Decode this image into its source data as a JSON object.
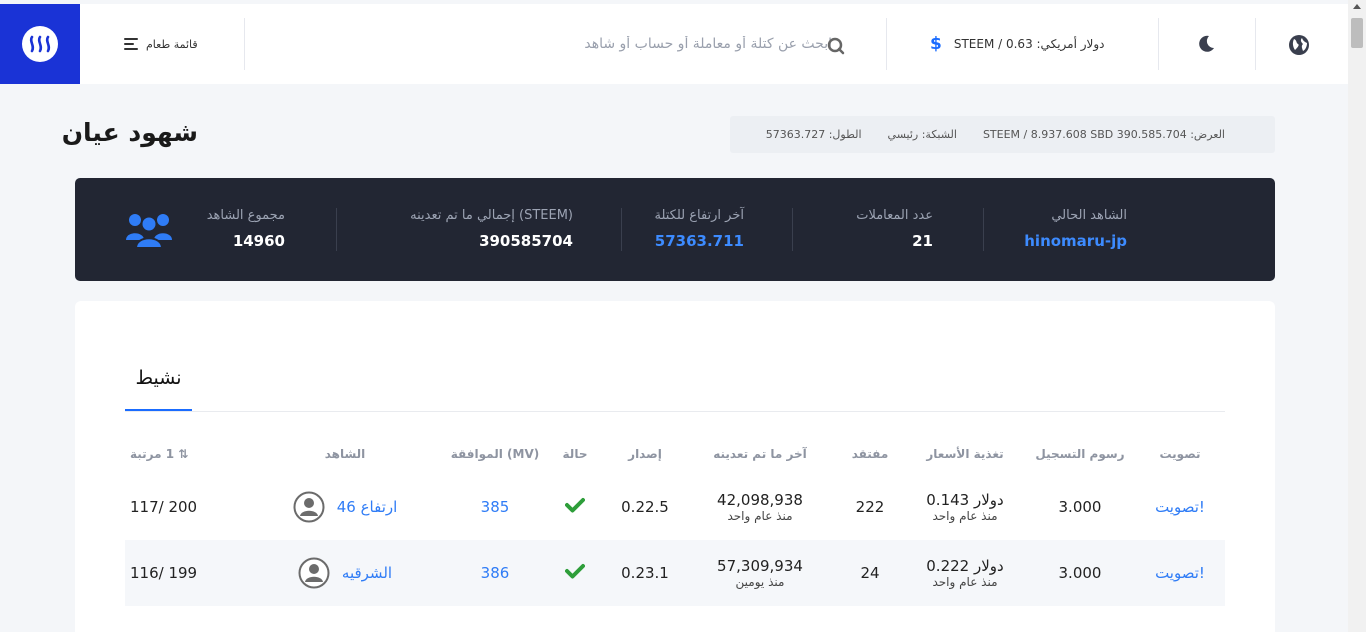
{
  "header": {
    "menu_label": "قائمة طعام",
    "search_placeholder": "ابحث عن كتلة أو معاملة أو حساب أو شاهد",
    "price_text": "دولار أمريكي: 0.63 / STEEM",
    "price_icon": "$"
  },
  "page": {
    "title": "شهود عيان",
    "height_text": "الطول: 57363.727",
    "network_text": "الشبكة: رئيسي",
    "supply_text": "العرض: 390.585.704 STEEM / 8.937.608 SBD"
  },
  "stats": {
    "current_witness_label": "الشاهد الحالي",
    "current_witness_value": "hinomaru-jp",
    "tx_count_label": "عدد المعاملات",
    "tx_count_value": "21",
    "last_block_label": "آخر ارتفاع للكتلة",
    "last_block_value": "57363.711",
    "total_mined_label": "(STEEM) إجمالي ما تم تعدينه",
    "total_mined_value": "390585704",
    "witness_total_label": "مجموع الشاهد",
    "witness_total_value": "14960"
  },
  "tabs": {
    "active": "نشيط"
  },
  "table": {
    "headers": {
      "vote": "تصويت",
      "reg_fee": "رسوم التسجيل",
      "price_feed": "تغذية الأسعار",
      "missed": "مفتقد",
      "last_mined": "آخر ما تم تعدينه",
      "version": "إصدار",
      "status": "حالة",
      "approval": "(MV) الموافقة",
      "witness": "الشاهد",
      "rank": "1 مرتبة"
    },
    "rows": [
      {
        "vote": "!تصويت",
        "reg_fee": "3.000",
        "price": "دولار 0.143",
        "price_time": "منذ عام واحد",
        "missed": "222",
        "last_block": "42,098,938",
        "last_time": "منذ عام واحد",
        "version": "0.22.5",
        "approval": "385",
        "witness": "ارتفاع 46",
        "rank": "200 /117"
      },
      {
        "vote": "!تصويت",
        "reg_fee": "3.000",
        "price": "دولار 0.222",
        "price_time": "منذ عام واحد",
        "missed": "24",
        "last_block": "57,309,934",
        "last_time": "منذ يومين",
        "version": "0.23.1",
        "approval": "386",
        "witness": "الشرقيه",
        "rank": "199 /116"
      }
    ]
  },
  "colors": {
    "brand": "#1a33d6",
    "accent": "#2f7cf6",
    "ok": "#2e9e3a",
    "dark_panel": "#222633"
  }
}
